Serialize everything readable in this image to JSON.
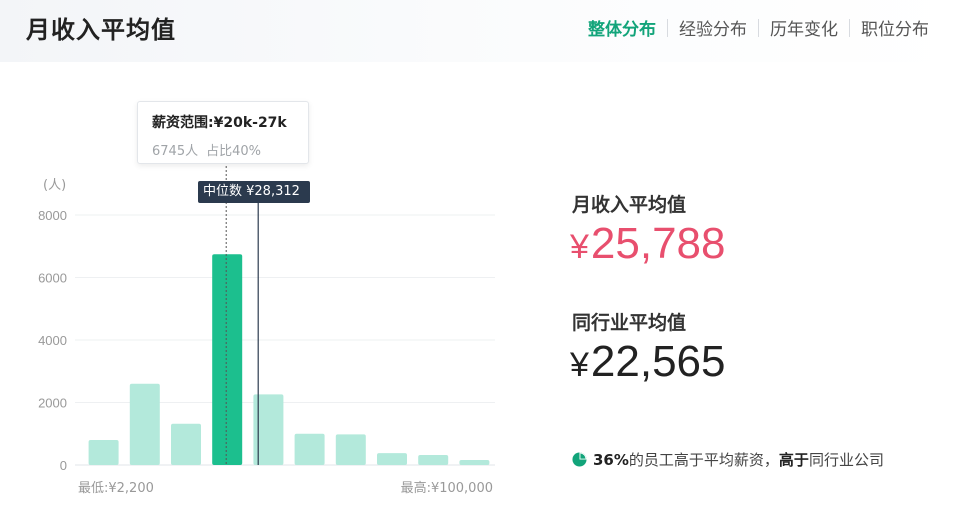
{
  "header": {
    "title": "月收入平均值",
    "tabs": [
      {
        "label": "整体分布",
        "active": true
      },
      {
        "label": "经验分布",
        "active": false
      },
      {
        "label": "历年变化",
        "active": false
      },
      {
        "label": "职位分布",
        "active": false
      }
    ]
  },
  "tooltip": {
    "range": "薪资范围:¥20k-27k",
    "count": "6745人",
    "share": "占比40%"
  },
  "median_label": "中位数 ¥28,312",
  "stats": {
    "avg_label": "月收入平均值",
    "avg_currency": "¥",
    "avg_value": "25,788",
    "industry_label": "同行业平均值",
    "industry_currency": "¥",
    "industry_value": "22,565"
  },
  "footnote": {
    "percent": "36%",
    "text1": "的员工高于平均薪资，",
    "emph": "高于",
    "text2": "同行业公司"
  },
  "colors": {
    "accent": "#12a47a",
    "bar_highlight": "#1cbf8e",
    "bar": "#b3e9db",
    "avg_value": "#e84f6e",
    "median_tag_bg": "#2b3a4e"
  },
  "chart_data": {
    "type": "bar",
    "yunit": "(人)",
    "ylim": [
      0,
      8000
    ],
    "yticks": [
      "0",
      "2000",
      "4000",
      "6000",
      "8000"
    ],
    "values": [
      800,
      2600,
      1320,
      6745,
      2260,
      1000,
      980,
      380,
      320,
      160
    ],
    "highlight_index": 3,
    "xmin_label": "最低:¥2,200",
    "xmax_label": "最高:¥100,000",
    "grid": true
  }
}
